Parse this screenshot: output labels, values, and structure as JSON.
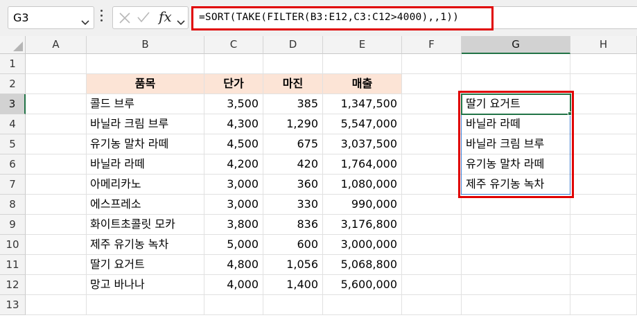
{
  "formula_bar": {
    "name_box": "G3",
    "fx_label": "fx",
    "formula": "=SORT(TAKE(FILTER(B3:E12,C3:C12>4000),,1))"
  },
  "columns": [
    "A",
    "B",
    "C",
    "D",
    "E",
    "F",
    "G",
    "H"
  ],
  "rows": [
    "1",
    "2",
    "3",
    "4",
    "5",
    "6",
    "7",
    "8",
    "9",
    "10",
    "11",
    "12",
    "13"
  ],
  "table": {
    "headers": [
      "품목",
      "단가",
      "마진",
      "매출"
    ],
    "rows": [
      [
        "콜드 브루",
        "3,500",
        "385",
        "1,347,500"
      ],
      [
        "바닐라 크림 브루",
        "4,300",
        "1,290",
        "5,547,000"
      ],
      [
        "유기농 말차 라떼",
        "4,500",
        "675",
        "3,037,500"
      ],
      [
        "바닐라 라떼",
        "4,200",
        "420",
        "1,764,000"
      ],
      [
        "아메리카노",
        "3,000",
        "360",
        "1,080,000"
      ],
      [
        "에스프레소",
        "3,000",
        "330",
        "990,000"
      ],
      [
        "화이트초콜릿 모카",
        "3,800",
        "836",
        "3,176,800"
      ],
      [
        "제주 유기농 녹차",
        "5,000",
        "600",
        "3,000,000"
      ],
      [
        "딸기 요거트",
        "4,800",
        "1,056",
        "5,068,800"
      ],
      [
        "망고 바나나",
        "4,000",
        "1,400",
        "5,600,000"
      ]
    ]
  },
  "result": [
    "딸기 요거트",
    "바닐라 라떼",
    "바닐라 크림 브루",
    "유기농 말차 라떼",
    "제주 유기농 녹차"
  ],
  "colors": {
    "header_fill": "#fce4d6",
    "highlight_red": "#e00000",
    "excel_green": "#217346",
    "spill_border": "#3c7dd0"
  },
  "icons": [
    "chevron-down-icon",
    "more-options-icon",
    "cancel-icon",
    "enter-icon",
    "insert-function-icon"
  ]
}
